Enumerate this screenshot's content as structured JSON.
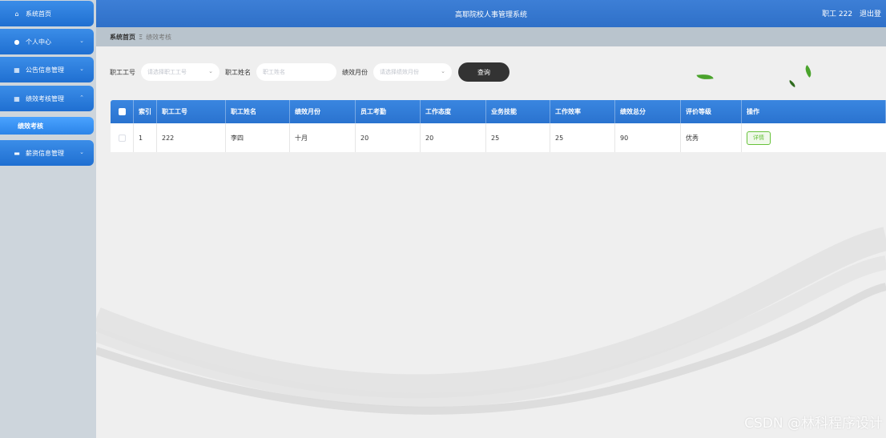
{
  "header": {
    "title": "高耶院校人事管理系统",
    "user": "职工 222",
    "logout": "退出登"
  },
  "sidebar": {
    "items": [
      {
        "label": "系统首页",
        "icon": "home-icon",
        "glyph": "⌂"
      },
      {
        "label": "个人中心",
        "icon": "user-icon",
        "glyph": "●"
      },
      {
        "label": "公告信息管理",
        "icon": "grid-icon",
        "glyph": "▦"
      },
      {
        "label": "绩效考核管理",
        "icon": "grid-icon",
        "glyph": "▦"
      },
      {
        "label": "薪资信息管理",
        "icon": "chat-icon",
        "glyph": "▬"
      }
    ],
    "submenu": {
      "label": "绩效考核"
    },
    "chevron": "⌄",
    "chevron_up": "⌃"
  },
  "breadcrumb": {
    "home": "系统首页",
    "separator": "Ξ",
    "current": "绩效考核"
  },
  "search": {
    "emp_no_label": "职工工号",
    "emp_no_placeholder": "请选择职工工号",
    "emp_name_label": "职工姓名",
    "emp_name_placeholder": "职工姓名",
    "month_label": "绩效月份",
    "month_placeholder": "请选择绩效月份",
    "query_button": "查询",
    "arrow": "⌄"
  },
  "table": {
    "columns": [
      "索引",
      "职工工号",
      "职工姓名",
      "绩效月份",
      "员工考勤",
      "工作态度",
      "业务技能",
      "工作效率",
      "绩效总分",
      "评价等级",
      "操作"
    ],
    "rows": [
      {
        "index": "1",
        "emp_no": "222",
        "name": "李四",
        "month": "十月",
        "attendance": "20",
        "attitude": "20",
        "skill": "25",
        "efficiency": "25",
        "total": "90",
        "grade": "优秀",
        "action": "详情"
      }
    ]
  },
  "watermark": "CSDN @林科程序设计",
  "colors": {
    "header": "#2f70c8",
    "sidebar_button": "#1f6fd1",
    "table_header": "#2a73cf",
    "detail_button": "#67c23a"
  }
}
